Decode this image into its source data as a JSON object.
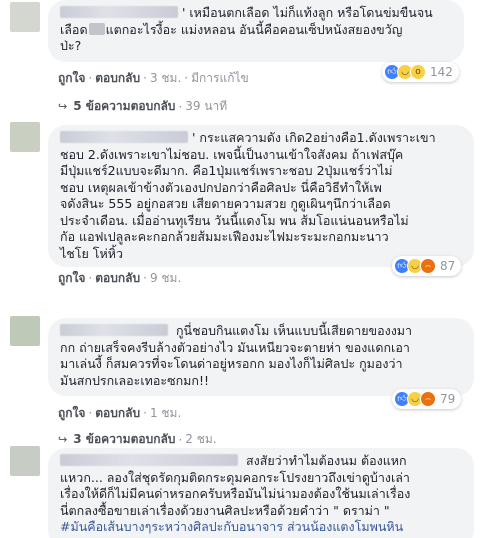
{
  "comments": [
    {
      "lines": [
        "' เหมือนตกเลือด ไม่ก็แท้งลูก หรือโดนข่มขืนจน",
        "เลือด",
        "แตกอะไรงี้อะ แม่งหลอน อันนี้คือคอนเซ็ปหนังสยองขวัญ",
        "ป่ะ?"
      ],
      "like": "ถูกใจ",
      "reply": "ตอบกลับ",
      "time": "3 ชม.",
      "extra": "มีการแก้ไข",
      "reactions_count": "142",
      "replies_label": "5 ข้อความตอบกลับ",
      "replies_time": "39 นาที"
    },
    {
      "lines": [
        "' กระแสความดัง เกิด2อย่างคือ1.ดังเพราะเขา",
        "ชอบ 2.ดังเพราะเขาไม่ชอบ. เพจนี้เป็นงานเข้าใจสังคม ถ้าเฟสบุ๊ค",
        "มีปุ่มแชร์2แบบจะดีมาก. คือ1ปุ่มแชร์เพราะชอบ 2ปุ่มแชร์ว่าไม่",
        "ชอบ เหตุผลเข้าข้างตัวเองปกปอกว่าคือศิลปะ นี่คือวิธีทำให้เพ",
        "จดังสินะ 555 อยู่กอสวย เสียดายความสวย กูดูเผินๆนึกว่าเลือด",
        "ประจำเดือน. เมื่ออ่านทุเรียน วันนี้แดงโม พน ส้มโอแน่นอนหรือไม่",
        "กัอ แอฟเปลูละคะกอกล้วยส้มมะเฟืองมะไฟมะระมะกอกมะนาว",
        "ไชโย โห่หิ้ว"
      ],
      "like": "ถูกใจ",
      "reply": "ตอบกลับ",
      "time": "9 ชม.",
      "reactions_count": "87"
    },
    {
      "lines": [
        " กูนี่ชอบกินแตงโม เห็นแบบนี้เสียดายของงมา",
        "กก ถ่ายเสร็จคงรีบล้างตัวอย่างไว มันเหนียวจะตายห่า ของแดกเอา",
        "มาเล่นงี้ ก็สมควรที่จะโดนด่าอยู่หรอกก มองไงก็ไม่ศิลปะ กูมองว่า",
        "มันสกปรกเลอะเทอะซกมก!!"
      ],
      "like": "ถูกใจ",
      "reply": "ตอบกลับ",
      "time": "1 ชม.",
      "reactions_count": "79",
      "replies_label": "3 ข้อความตอบกลับ",
      "replies_time": "2 ชม."
    },
    {
      "lines": [
        " สงสัยว่าทำไมต้องนม ต้องแหก",
        "แหวก... ลองใส่ชุดรัดกุมติดกระดุมคอกระโปรงยาวถึงเข่าดูบ้างเล่า",
        "เรื่องให้ดีก็ไม่มีคนด่าหรอกครับหรือมันไม่น่ามองต้องใช้นมเล่าเรื่อง",
        "นี่ตกลงซื้อขายเล่าเรื่องด้วยงานศิลปะหรือด้วยคำว่า \" ดราม่า \"",
        "#มันคือเส้นบางๆระหว่างศิลปะกับอนาจาร ส่วนน้องแตงโมพนหิน"
      ]
    }
  ],
  "colors": {
    "bubble_bg": "#f2f3f5",
    "text": "#1d2129",
    "action_text": "#4b4f56",
    "meta_text": "#90949c",
    "like_blue": "#4080ff",
    "haha_yellow": "#f7d046",
    "angry_orange": "#e9710f"
  },
  "icons": [
    "like-reaction-icon",
    "haha-reaction-icon",
    "wow-reaction-icon",
    "angry-reaction-icon",
    "reply-arrow-icon"
  ]
}
